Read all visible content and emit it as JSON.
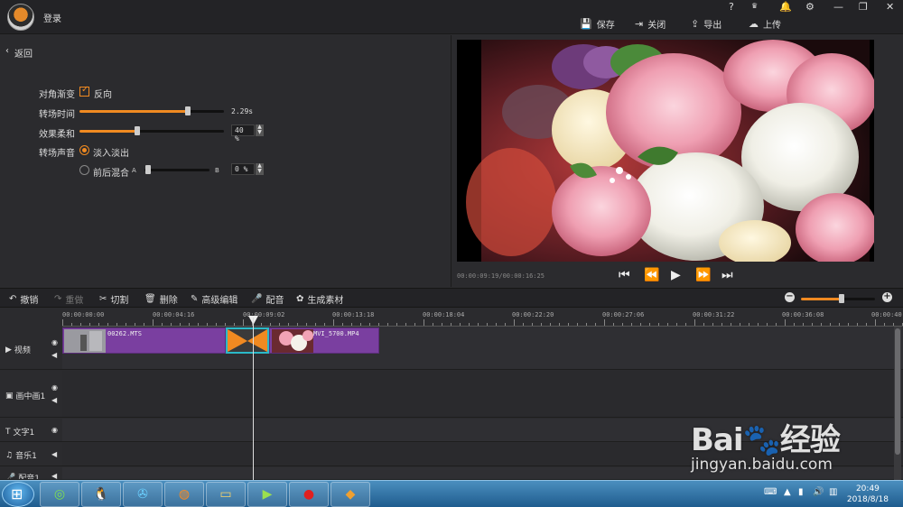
{
  "header": {
    "login_label": "登录",
    "window_controls": [
      "?",
      "VIP",
      "🔔",
      "⚙",
      "—",
      "❐",
      "✕"
    ],
    "actions": [
      {
        "icon": "save-icon",
        "label": "保存"
      },
      {
        "icon": "close-icon",
        "label": "关闭"
      },
      {
        "icon": "export-icon",
        "label": "导出"
      },
      {
        "icon": "upload-icon",
        "label": "上传"
      }
    ]
  },
  "left_panel": {
    "back_label": "返回",
    "diagonal_label": "对角渐变",
    "reverse_label": "反向",
    "reverse_checked": true,
    "duration_label": "转场时间",
    "duration_value": "2.29s",
    "duration_fraction": 0.75,
    "softness_label": "效果柔和",
    "softness_value": "40 %",
    "softness_fraction": 0.4,
    "audio_label": "转场声音",
    "fade_label": "淡入淡出",
    "mix_label": "前后混合",
    "mix_a": "A",
    "mix_b": "B",
    "mix_value": "0 %"
  },
  "preview": {
    "timecode": "00:00:09:19/00:00:16:25"
  },
  "toolbar": {
    "undo_label": "撤销",
    "redo_label": "重做",
    "cut_label": "切割",
    "delete_label": "删除",
    "advanced_label": "高级编辑",
    "dub_label": "配音",
    "generate_label": "生成素材",
    "zoom_fraction": 0.55
  },
  "timeline": {
    "ticks": [
      "00:00:00:00",
      "00:00:04:16",
      "00:00:09:02",
      "00:00:13:18",
      "00:00:18:04",
      "00:00:22:20",
      "00:00:27:06",
      "00:00:31:22",
      "00:00:36:08",
      "00:00:40:"
    ],
    "tracks": {
      "video": "视频",
      "pip": "画中画1",
      "text": "文字1",
      "music": "音乐1",
      "dub": "配音1"
    },
    "clip1_label": "00262.MTS",
    "clip2_label": "MVI_5700.MP4"
  },
  "taskbar": {
    "time": "20:49",
    "date": "2018/8/18"
  },
  "watermark": {
    "brand": "Bai",
    "brand_cn": "经验",
    "url": "jingyan.baidu.com"
  },
  "colors": {
    "accent": "#f08a21",
    "clip": "#7a3fa0",
    "transition_border": "#2bb9c8"
  }
}
